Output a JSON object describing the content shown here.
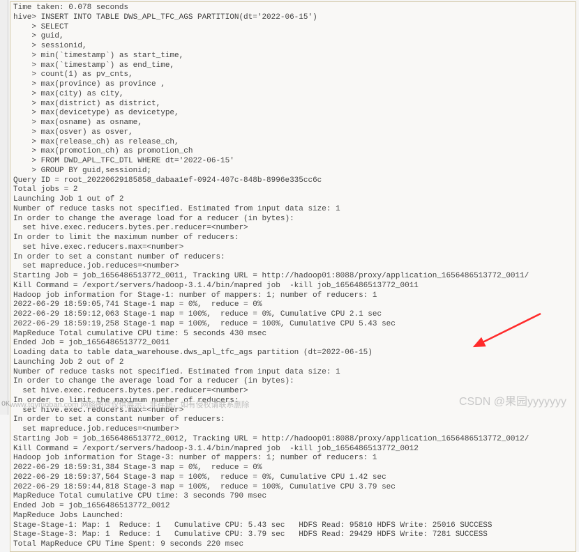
{
  "terminal": {
    "lines": [
      "Time taken: 0.078 seconds",
      "hive> INSERT INTO TABLE DWS_APL_TFC_AGS PARTITION(dt='2022-06-15')",
      "    > SELECT",
      "    > guid,",
      "    > sessionid,",
      "    > min(`timestamp`) as start_time,",
      "    > max(`timestamp`) as end_time,",
      "    > count(1) as pv_cnts,",
      "    > max(province) as province ,",
      "    > max(city) as city,",
      "    > max(district) as district,",
      "    > max(devicetype) as devicetype,",
      "    > max(osname) as osname,",
      "    > max(osver) as osver,",
      "    > max(release_ch) as release_ch,",
      "    > max(promotion_ch) as promotion_ch",
      "    > FROM DWD_APL_TFC_DTL WHERE dt='2022-06-15'",
      "    > GROUP BY guid,sessionid;",
      "Query ID = root_20220629185858_dabaa1ef-0924-407c-848b-8996e335cc6c",
      "Total jobs = 2",
      "Launching Job 1 out of 2",
      "Number of reduce tasks not specified. Estimated from input data size: 1",
      "In order to change the average load for a reducer (in bytes):",
      "  set hive.exec.reducers.bytes.per.reducer=<number>",
      "In order to limit the maximum number of reducers:",
      "  set hive.exec.reducers.max=<number>",
      "In order to set a constant number of reducers:",
      "  set mapreduce.job.reduces=<number>",
      "Starting Job = job_1656486513772_0011, Tracking URL = http://hadoop01:8088/proxy/application_1656486513772_0011/",
      "Kill Command = /export/servers/hadoop-3.1.4/bin/mapred job  -kill job_1656486513772_0011",
      "Hadoop job information for Stage-1: number of mappers: 1; number of reducers: 1",
      "2022-06-29 18:59:05,741 Stage-1 map = 0%,  reduce = 0%",
      "2022-06-29 18:59:12,063 Stage-1 map = 100%,  reduce = 0%, Cumulative CPU 2.1 sec",
      "2022-06-29 18:59:19,258 Stage-1 map = 100%,  reduce = 100%, Cumulative CPU 5.43 sec",
      "MapReduce Total cumulative CPU time: 5 seconds 430 msec",
      "Ended Job = job_1656486513772_0011",
      "Loading data to table data_warehouse.dws_apl_tfc_ags partition (dt=2022-06-15)",
      "Launching Job 2 out of 2",
      "Number of reduce tasks not specified. Estimated from input data size: 1",
      "In order to change the average load for a reducer (in bytes):",
      "  set hive.exec.reducers.bytes.per.reducer=<number>",
      "In order to limit the maximum number of reducers:",
      "  set hive.exec.reducers.max=<number>",
      "In order to set a constant number of reducers:",
      "  set mapreduce.job.reduces=<number>",
      "Starting Job = job_1656486513772_0012, Tracking URL = http://hadoop01:8088/proxy/application_1656486513772_0012/",
      "Kill Command = /export/servers/hadoop-3.1.4/bin/mapred job  -kill job_1656486513772_0012",
      "Hadoop job information for Stage-3: number of mappers: 1; number of reducers: 1",
      "2022-06-29 18:59:31,384 Stage-3 map = 0%,  reduce = 0%",
      "2022-06-29 18:59:37,564 Stage-3 map = 100%,  reduce = 0%, Cumulative CPU 1.42 sec",
      "2022-06-29 18:59:44,818 Stage-3 map = 100%,  reduce = 100%, Cumulative CPU 3.79 sec",
      "MapReduce Total cumulative CPU time: 3 seconds 790 msec",
      "Ended Job = job_1656486513772_0012",
      "MapReduce Jobs Launched:",
      "Stage-Stage-1: Map: 1  Reduce: 1   Cumulative CPU: 5.43 sec   HDFS Read: 95810 HDFS Write: 25016 SUCCESS",
      "Stage-Stage-3: Map: 1  Reduce: 1   Cumulative CPU: 3.79 sec   HDFS Read: 29429 HDFS Write: 7281 SUCCESS",
      "Total MapReduce CPU Time Spent: 9 seconds 220 msec"
    ]
  },
  "watermarks": {
    "left": "www.toymoban.com  网络图片仅供展示，非存储，如有侵权请联系删除",
    "right": "CSDN @果园yyyyyyy",
    "ok": "OK"
  },
  "colors": {
    "arrow": "#ff2b2b"
  }
}
